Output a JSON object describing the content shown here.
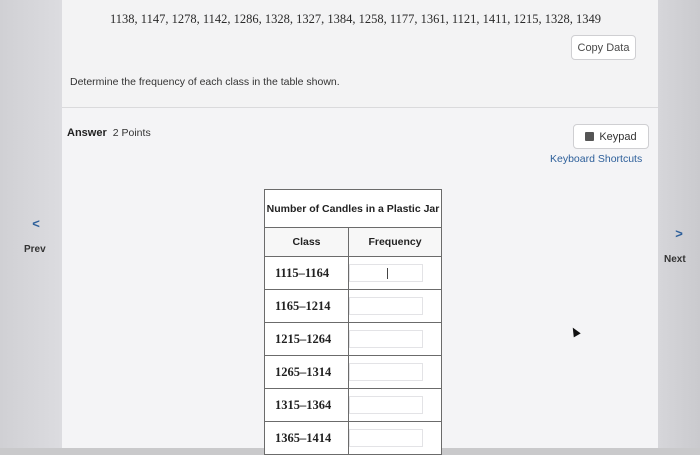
{
  "data_values": "1138, 1147, 1278, 1142, 1286, 1328, 1327, 1384, 1258, 1177, 1361, 1121, 1411, 1215, 1328, 1349",
  "copy_button": "Copy Data",
  "question": "Determine the frequency of each class in the table shown.",
  "answer": {
    "label": "Answer",
    "points": "2 Points"
  },
  "keypad_button": "Keypad",
  "keyboard_shortcuts": "Keyboard Shortcuts",
  "nav": {
    "prev": "Prev",
    "next": "Next",
    "prev_glyph": "<",
    "next_glyph": ">"
  },
  "table": {
    "caption": "Number of Candles in a Plastic Jar",
    "col_class": "Class",
    "col_frequency": "Frequency",
    "rows": [
      {
        "class": "1115–1164",
        "frequency": ""
      },
      {
        "class": "1165–1214",
        "frequency": ""
      },
      {
        "class": "1215–1264",
        "frequency": ""
      },
      {
        "class": "1265–1314",
        "frequency": ""
      },
      {
        "class": "1315–1364",
        "frequency": ""
      },
      {
        "class": "1365–1414",
        "frequency": ""
      }
    ]
  },
  "colors": {
    "link": "#2d5f9a",
    "background": "#c9c9cb"
  }
}
